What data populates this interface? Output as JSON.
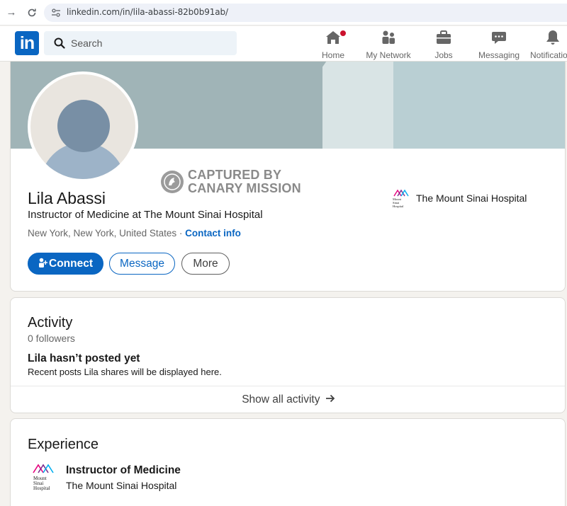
{
  "browser": {
    "url": "linkedin.com/in/lila-abassi-82b0b91ab/"
  },
  "header": {
    "logo": "in",
    "search_placeholder": "Search",
    "nav": [
      {
        "label": "Home",
        "icon": "home-icon"
      },
      {
        "label": "My Network",
        "icon": "network-icon"
      },
      {
        "label": "Jobs",
        "icon": "briefcase-icon"
      },
      {
        "label": "Messaging",
        "icon": "messaging-icon"
      },
      {
        "label": "Notifications",
        "icon": "bell-icon"
      }
    ]
  },
  "watermark": {
    "line1": "CAPTURED BY",
    "line2": "CANARY MISSION"
  },
  "profile": {
    "name": "Lila Abassi",
    "headline": "Instructor of Medicine at The Mount Sinai Hospital",
    "location": "New York, New York, United States",
    "separator": " · ",
    "contact_label": "Contact info",
    "current_company": "The Mount Sinai Hospital",
    "logo_text": [
      "Mount",
      "Sinai",
      "Hospital"
    ],
    "buttons": {
      "connect": "Connect",
      "message": "Message",
      "more": "More"
    }
  },
  "activity": {
    "title": "Activity",
    "followers": "0 followers",
    "empty_title": "Lila hasn’t posted yet",
    "empty_sub": "Recent posts Lila shares will be displayed here.",
    "show_all": "Show all activity"
  },
  "experience": {
    "title": "Experience",
    "items": [
      {
        "role": "Instructor of Medicine",
        "company": "The Mount Sinai Hospital"
      }
    ]
  },
  "colors": {
    "brand": "#0a66c2",
    "notification": "#cb112d"
  }
}
